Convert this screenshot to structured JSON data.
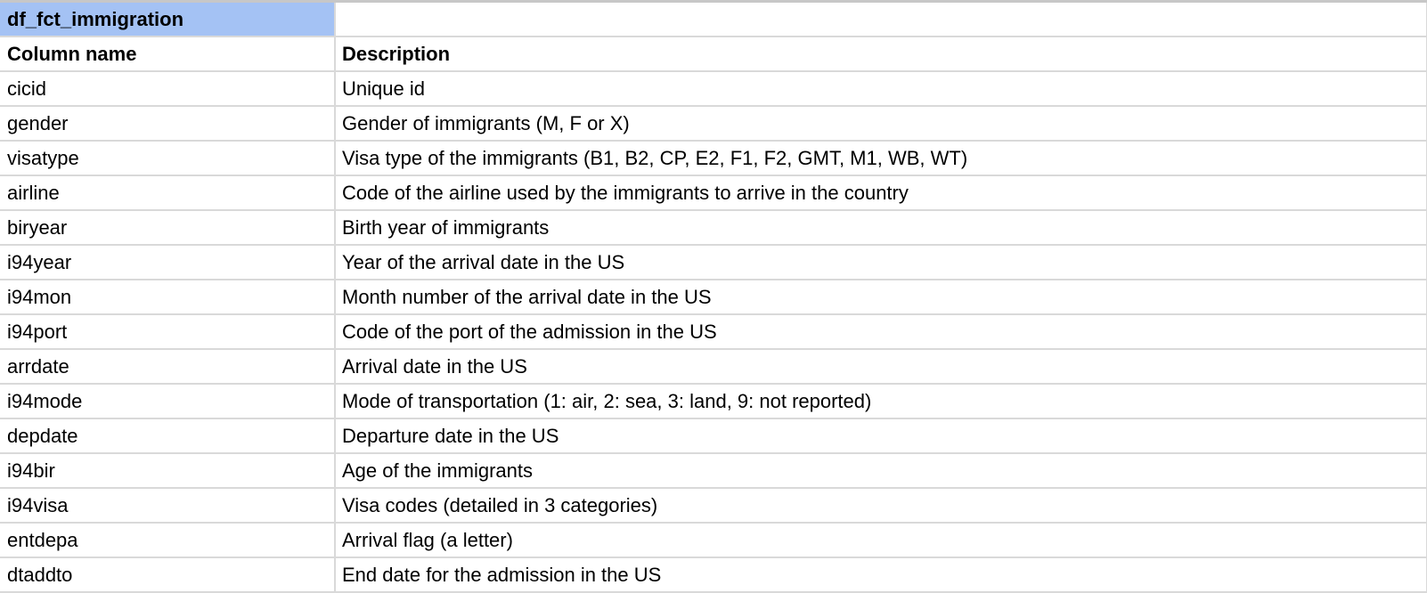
{
  "sheet": {
    "table_title": "df_fct_immigration",
    "headers": {
      "column_name": "Column name",
      "description": "Description"
    },
    "rows": [
      {
        "name": "cicid",
        "description": "Unique id"
      },
      {
        "name": "gender",
        "description": "Gender of immigrants (M, F or X)"
      },
      {
        "name": "visatype",
        "description": "Visa type of the immigrants (B1, B2, CP, E2, F1, F2, GMT, M1, WB, WT)"
      },
      {
        "name": "airline",
        "description": "Code of the airline used by the immigrants to arrive in the country"
      },
      {
        "name": "biryear",
        "description": "Birth year of immigrants"
      },
      {
        "name": "i94year",
        "description": "Year of the arrival date in the US"
      },
      {
        "name": "i94mon",
        "description": "Month number of the arrival date in the US"
      },
      {
        "name": "i94port",
        "description": "Code of the port of the admission in the US"
      },
      {
        "name": "arrdate",
        "description": "Arrival date in the US"
      },
      {
        "name": "i94mode",
        "description": "Mode of transportation (1: air, 2: sea, 3: land, 9: not reported)"
      },
      {
        "name": "depdate",
        "description": "Departure date in the US"
      },
      {
        "name": "i94bir",
        "description": "Age of the immigrants"
      },
      {
        "name": "i94visa",
        "description": "Visa codes (detailed in 3 categories)"
      },
      {
        "name": "entdepa",
        "description": "Arrival flag (a letter)"
      },
      {
        "name": "dtaddto",
        "description": "End date for the admission in the US"
      }
    ]
  },
  "colors": {
    "title_fill": "#a4c2f4",
    "gridline": "#d9d9d9"
  }
}
